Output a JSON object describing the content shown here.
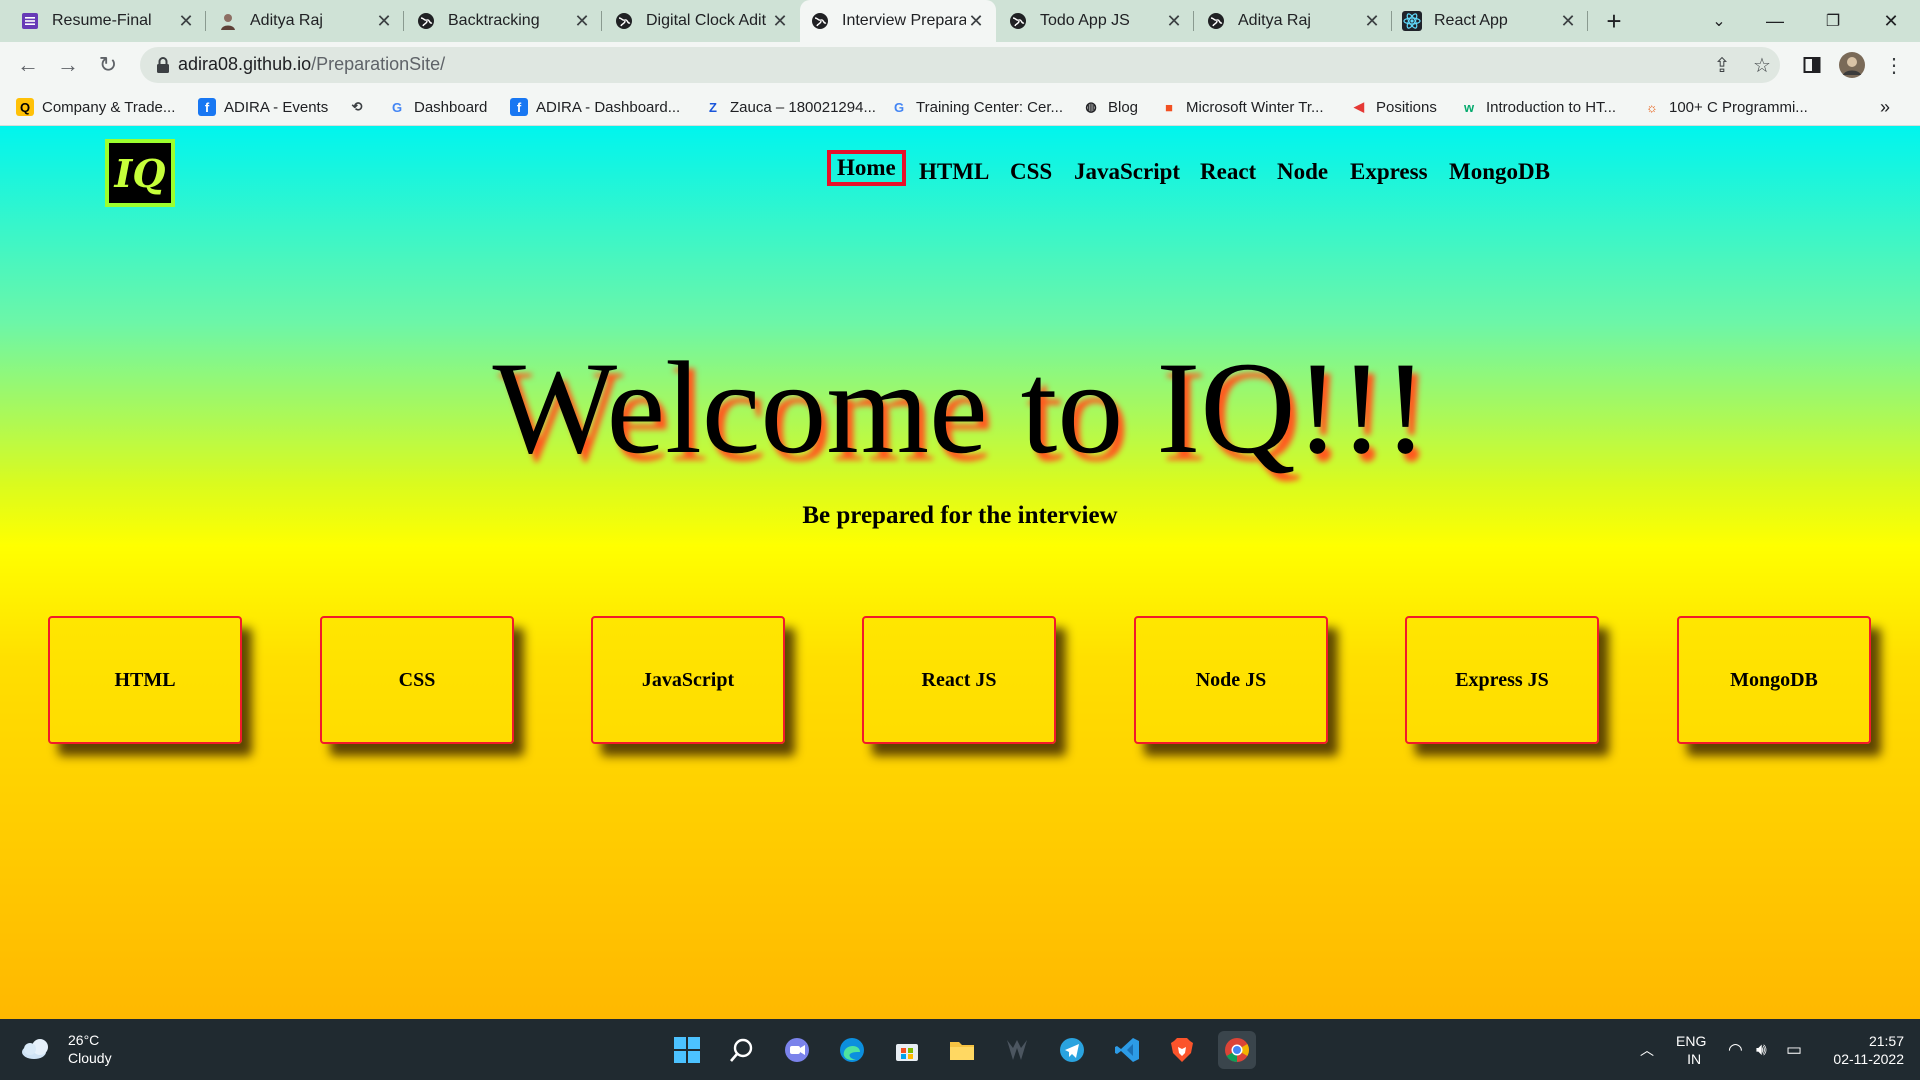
{
  "tabs": [
    {
      "title": "Resume-Final",
      "icon": "sheets-icon",
      "color": "#673ab7"
    },
    {
      "title": "Aditya Raj",
      "icon": "avatar-icon",
      "color": "#8d6e63"
    },
    {
      "title": "Backtracking",
      "icon": "globe-icon",
      "color": "#202124"
    },
    {
      "title": "Digital Clock Adit",
      "icon": "globe-icon",
      "color": "#202124"
    },
    {
      "title": "Interview Prepara",
      "icon": "globe-icon",
      "color": "#202124",
      "active": true
    },
    {
      "title": "Todo App JS",
      "icon": "globe-icon",
      "color": "#202124"
    },
    {
      "title": "Aditya Raj",
      "icon": "globe-icon",
      "color": "#202124"
    },
    {
      "title": "React App",
      "icon": "react-icon",
      "color": "#61dafb"
    }
  ],
  "toolbar": {
    "url_host": "adira08.github.io",
    "url_path": "/PreparationSite/"
  },
  "bookmarks": [
    {
      "label": "Company & Trade...",
      "icon": "q-icon",
      "glyph": "Q",
      "bg": "#ffc107",
      "fg": "#000"
    },
    {
      "label": "ADIRA - Events",
      "icon": "facebook-icon",
      "glyph": "f",
      "bg": "#1877f2",
      "fg": "#fff"
    },
    {
      "label": "",
      "icon": "history-icon",
      "glyph": "⟲",
      "bg": "transparent",
      "fg": "#3c4043"
    },
    {
      "label": "Dashboard",
      "icon": "google-icon",
      "glyph": "G",
      "bg": "transparent",
      "fg": "#4285f4"
    },
    {
      "label": "ADIRA - Dashboard...",
      "icon": "facebook-icon",
      "glyph": "f",
      "bg": "#1877f2",
      "fg": "#fff"
    },
    {
      "label": "Zauca – 180021294...",
      "icon": "zauca-icon",
      "glyph": "Z",
      "bg": "transparent",
      "fg": "#1a56db"
    },
    {
      "label": "Training Center: Cer...",
      "icon": "google-icon",
      "glyph": "G",
      "bg": "transparent",
      "fg": "#4285f4"
    },
    {
      "label": "Blog",
      "icon": "globe-icon",
      "glyph": "◍",
      "bg": "transparent",
      "fg": "#202124"
    },
    {
      "label": "Microsoft Winter Tr...",
      "icon": "microsoft-icon",
      "glyph": "■",
      "bg": "transparent",
      "fg": "#f25022"
    },
    {
      "label": "Positions",
      "icon": "positions-icon",
      "glyph": "◀",
      "bg": "transparent",
      "fg": "#e53935"
    },
    {
      "label": "Introduction to HT...",
      "icon": "w3schools-icon",
      "glyph": "w",
      "bg": "transparent",
      "fg": "#04aa6d"
    },
    {
      "label": "100+ C Programmi...",
      "icon": "c-programming-icon",
      "glyph": "☼",
      "bg": "transparent",
      "fg": "#e65100"
    }
  ],
  "site": {
    "logo": "IQ",
    "nav": [
      "Home",
      "HTML",
      "CSS",
      "JavaScript",
      "React",
      "Node",
      "Express",
      "MongoDB"
    ],
    "active_nav": "Home",
    "hero_title": "Welcome to IQ!!!",
    "subtitle": "Be prepared for the interview",
    "cards": [
      "HTML",
      "CSS",
      "JavaScript",
      "React JS",
      "Node JS",
      "Express JS",
      "MongoDB"
    ]
  },
  "taskbar": {
    "weather_temp": "26°C",
    "weather_desc": "Cloudy",
    "apps": [
      "windows-start-icon",
      "search-icon",
      "chat-icon",
      "edge-icon",
      "store-icon",
      "file-explorer-icon",
      "acer-icon",
      "telegram-icon",
      "vscode-icon",
      "brave-icon",
      "chrome-icon"
    ],
    "lang": "ENG",
    "region": "IN",
    "time": "21:57",
    "date": "02-11-2022"
  }
}
